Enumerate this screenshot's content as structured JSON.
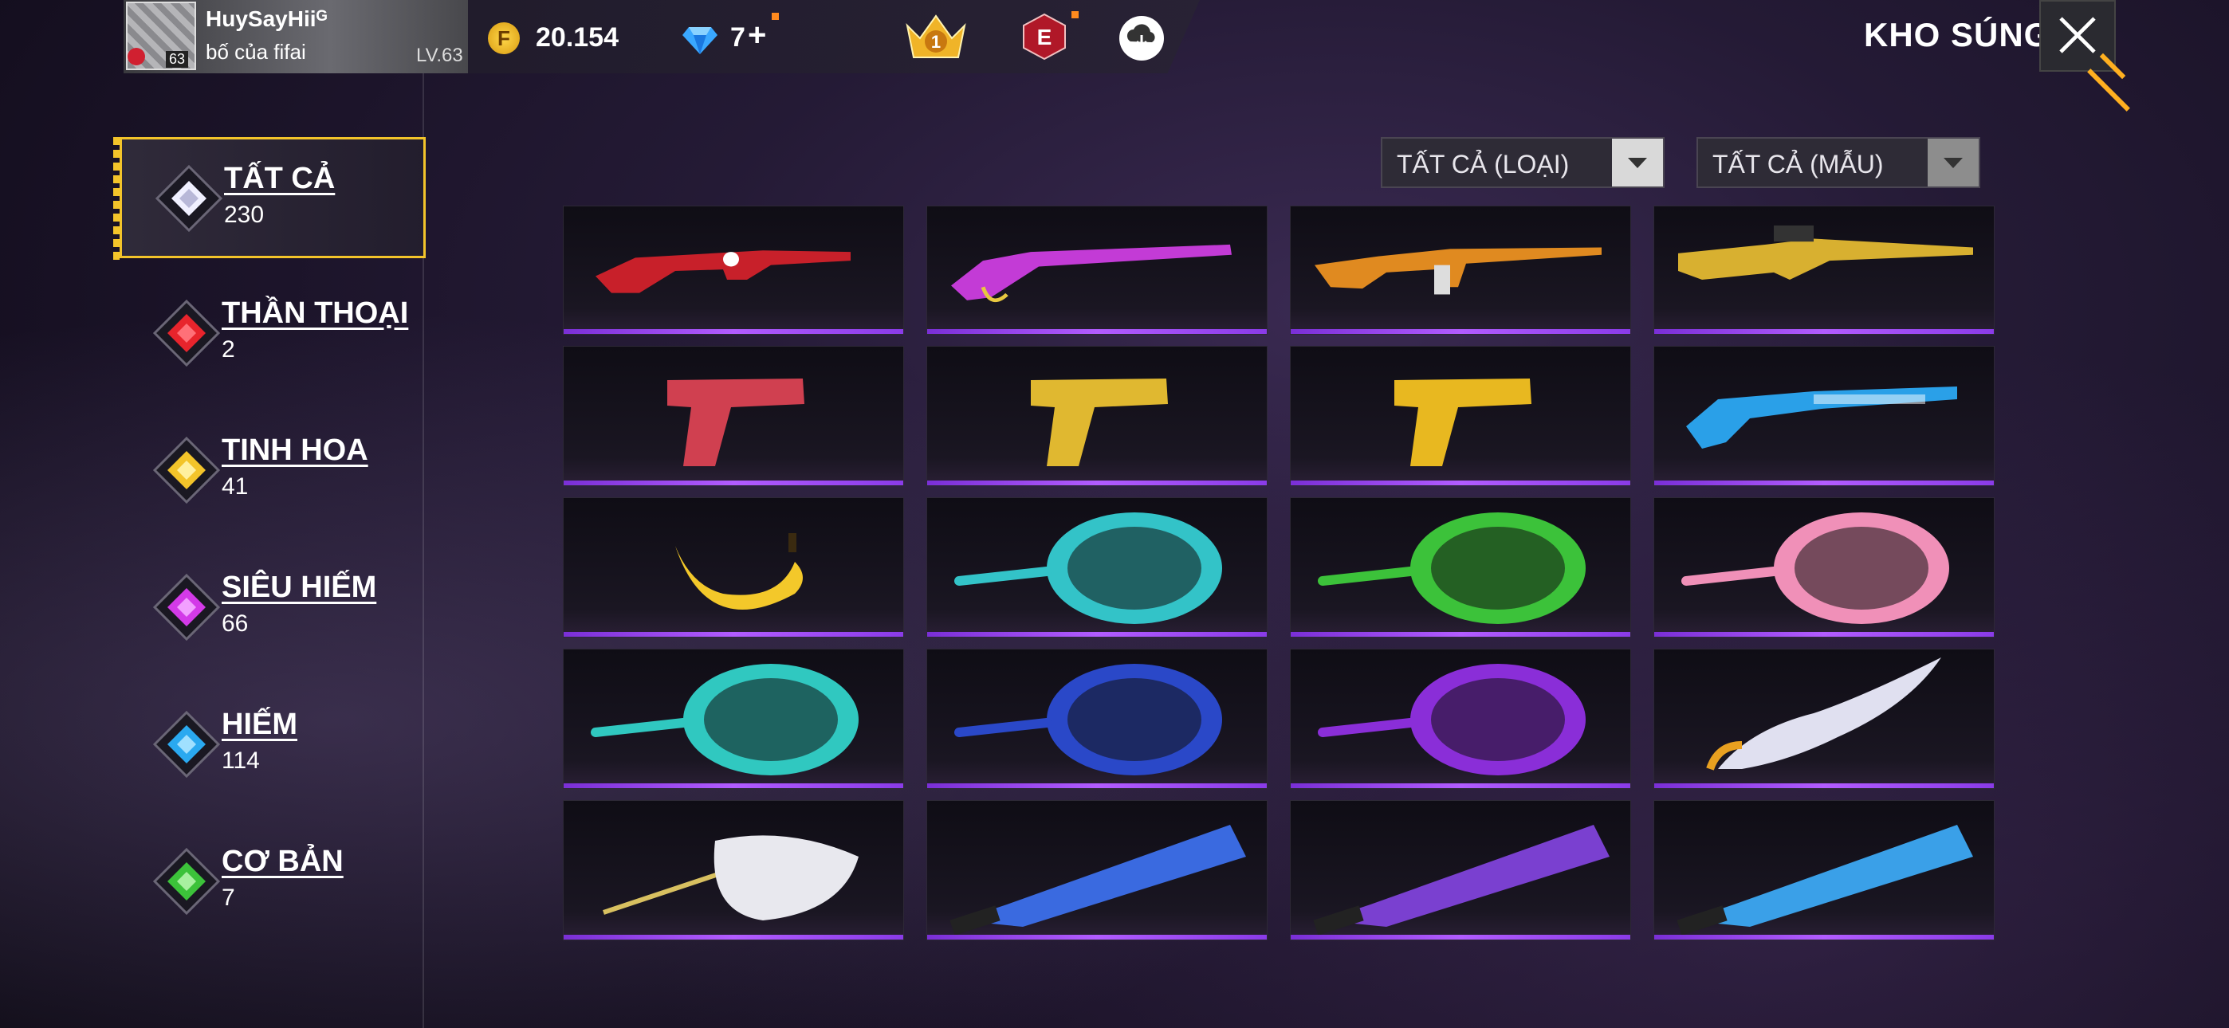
{
  "header": {
    "player_name": "HuySayHiiᴳ",
    "player_subtitle": "bố của fifai",
    "level": "LV.63",
    "avatar_level": "63",
    "coins": "20.154",
    "diamonds": "7",
    "diamond_plus": "+",
    "crown_rank": "1",
    "e_badge": "E",
    "title": "KHO SÚNG"
  },
  "sidebar": {
    "categories": [
      {
        "label": "TẤT CẢ",
        "count": "230",
        "color": "#e8e8ff"
      },
      {
        "label": "THẦN THOẠI",
        "count": "2",
        "color": "#e8242c"
      },
      {
        "label": "TINH HOA",
        "count": "41",
        "color": "#f3c42a"
      },
      {
        "label": "SIÊU HIẾM",
        "count": "66",
        "color": "#d33ae8"
      },
      {
        "label": "HIẾM",
        "count": "114",
        "color": "#2aa9f0"
      },
      {
        "label": "CƠ BẢN",
        "count": "7",
        "color": "#3cc23a"
      }
    ]
  },
  "filters": {
    "type_label": "TẤT CẢ (LOẠI)",
    "skin_label": "TẤT CẢ (MẪU)"
  },
  "items": [
    {
      "icon": "smg-red-skin-icon",
      "color": "#c8202a"
    },
    {
      "icon": "shotgun-purple-skin-icon",
      "color": "#c33bd6"
    },
    {
      "icon": "rifle-tiger-skin-icon",
      "color": "#e08a20"
    },
    {
      "icon": "lmg-gold-skin-icon",
      "color": "#d8b030"
    },
    {
      "icon": "pistol-red-skin-icon",
      "color": "#d04050"
    },
    {
      "icon": "desert-eagle-gold-icon",
      "color": "#e0b830"
    },
    {
      "icon": "pistol-gold-icon",
      "color": "#e8b820"
    },
    {
      "icon": "shotgun-blue-skin-icon",
      "color": "#2aa0e8"
    },
    {
      "icon": "banana-icon",
      "color": "#f3c82a"
    },
    {
      "icon": "pan-alien-icon",
      "color": "#33c3c8"
    },
    {
      "icon": "pan-green-icon",
      "color": "#3cc23a"
    },
    {
      "icon": "pan-pink-icon",
      "color": "#f090b8"
    },
    {
      "icon": "pan-snowflake-icon",
      "color": "#30c8c0"
    },
    {
      "icon": "pan-blue-red-icon",
      "color": "#2a48c8"
    },
    {
      "icon": "pan-purple-icon",
      "color": "#8a2ed8"
    },
    {
      "icon": "sword-gold-icon",
      "color": "#e0e0f0"
    },
    {
      "icon": "bat-wrapped-icon",
      "color": "#e8e8ee"
    },
    {
      "icon": "machete-green-icon",
      "color": "#3a6ae0"
    },
    {
      "icon": "machete-purple-icon",
      "color": "#7a40d0"
    },
    {
      "icon": "machete-blue-icon",
      "color": "#3aa0e8"
    }
  ]
}
